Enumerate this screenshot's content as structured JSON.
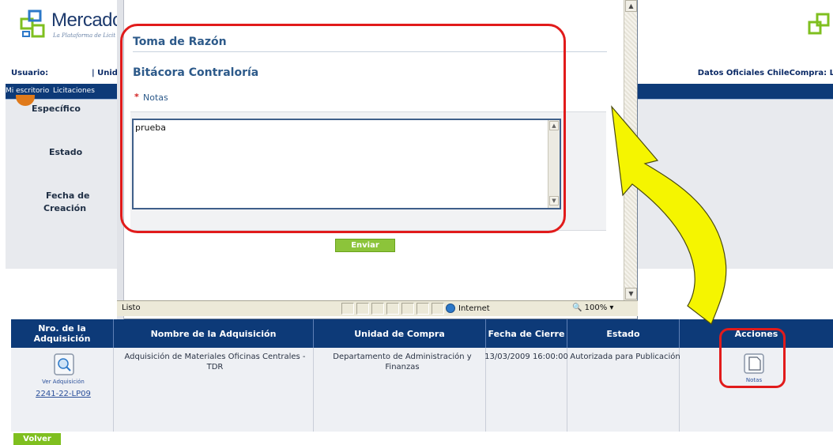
{
  "site": {
    "brand": "Mercadol",
    "tagline": "La Plataforma de Licit"
  },
  "userbar": {
    "user_label": "Usuario:",
    "unit_label": "| Unida",
    "official_data": "Datos Oficiales ChileCompra: L"
  },
  "nav": {
    "items": [
      "Mi escritorio",
      "Licitaciones"
    ]
  },
  "left_panel": {
    "step_label": "Específico",
    "estado_label": "Estado",
    "fecha_label_1": "Fecha de",
    "fecha_label_2": "Creación"
  },
  "popup": {
    "title": "Toma de Razón",
    "subtitle": "Bitácora Contraloría",
    "required_mark": "*",
    "notes_label": "Notas",
    "notes_value": "prueba",
    "submit_label": "Enviar",
    "status_text": "Listo",
    "zone_text": "Internet",
    "zoom_text": "100%"
  },
  "table": {
    "headers": [
      "Nro. de la Adquisición",
      "Nombre de la Adquisición",
      "Unidad de Compra",
      "Fecha de Cierre",
      "Estado",
      "Acciones"
    ],
    "row": {
      "view_label": "Ver Adquisición",
      "id": "2241-22-LP09",
      "name": "Adquisición de Materiales Oficinas Centrales - TDR",
      "unit": "Departamento de Administración y Finanzas",
      "close_date": "13/03/2009 16:00:00",
      "status": "Autorizada para Publicación",
      "action_label": "Notas"
    }
  },
  "footer": {
    "back_label": "Volver"
  },
  "colors": {
    "nav_blue": "#0d3a78",
    "title_blue": "#2d5a8a",
    "button_green": "#8cc43a",
    "annotation_red": "#e11b1b",
    "arrow_yellow": "#f5f500"
  },
  "icons": [
    "mercado-logo-icon",
    "search-doc-icon",
    "notes-icon",
    "internet-globe-icon",
    "zoom-icon"
  ]
}
